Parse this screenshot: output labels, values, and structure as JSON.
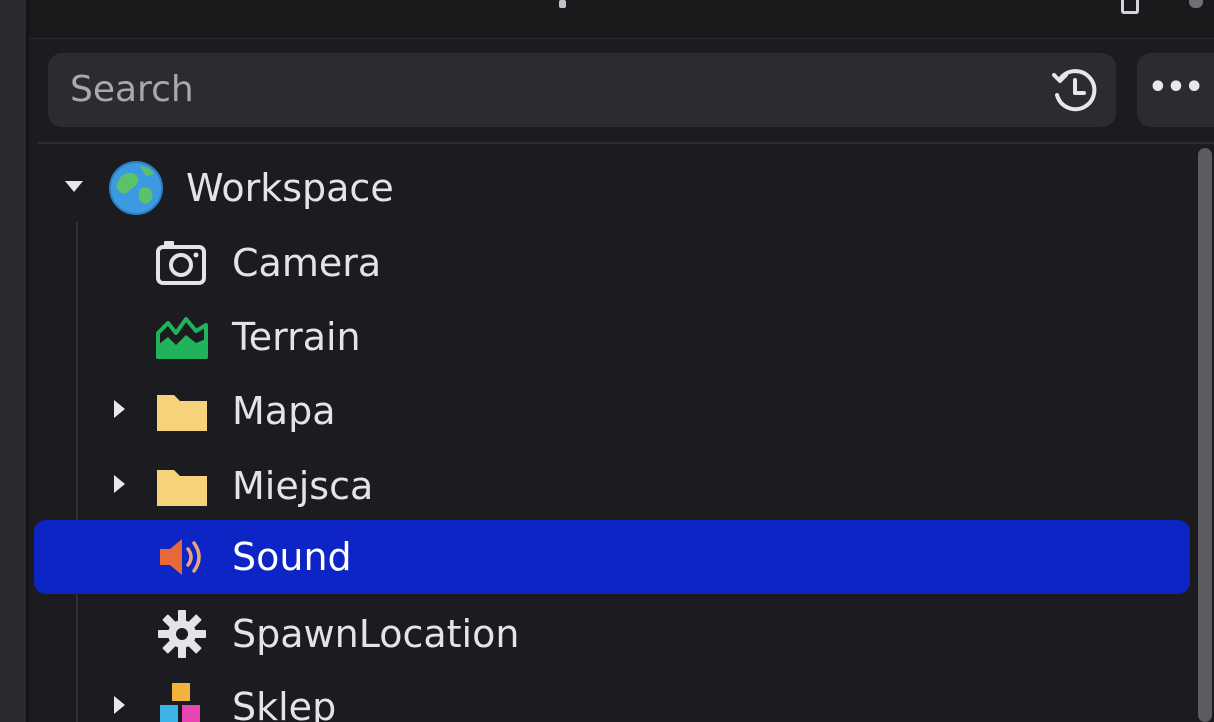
{
  "search": {
    "placeholder": "Search"
  },
  "toolbar": {
    "more_label": "•••"
  },
  "tree": {
    "items": [
      {
        "label": "Workspace",
        "icon": "globe-icon",
        "expanded": true
      },
      {
        "label": "Camera",
        "icon": "camera-icon"
      },
      {
        "label": "Terrain",
        "icon": "terrain-icon"
      },
      {
        "label": "Mapa",
        "icon": "folder-icon",
        "expanded": false
      },
      {
        "label": "Miejsca",
        "icon": "folder-icon",
        "expanded": false
      },
      {
        "label": "Sound",
        "icon": "speaker-icon",
        "selected": true
      },
      {
        "label": "SpawnLocation",
        "icon": "gear-icon"
      },
      {
        "label": "Sklep",
        "icon": "model-icon",
        "expanded": false
      }
    ]
  },
  "colors": {
    "selection": "#0d25c4",
    "folder": "#f6d27a",
    "terrain": "#21b35b",
    "speaker": "#e8683a",
    "globe_blue": "#3c9be0",
    "globe_green": "#5cc26a"
  }
}
